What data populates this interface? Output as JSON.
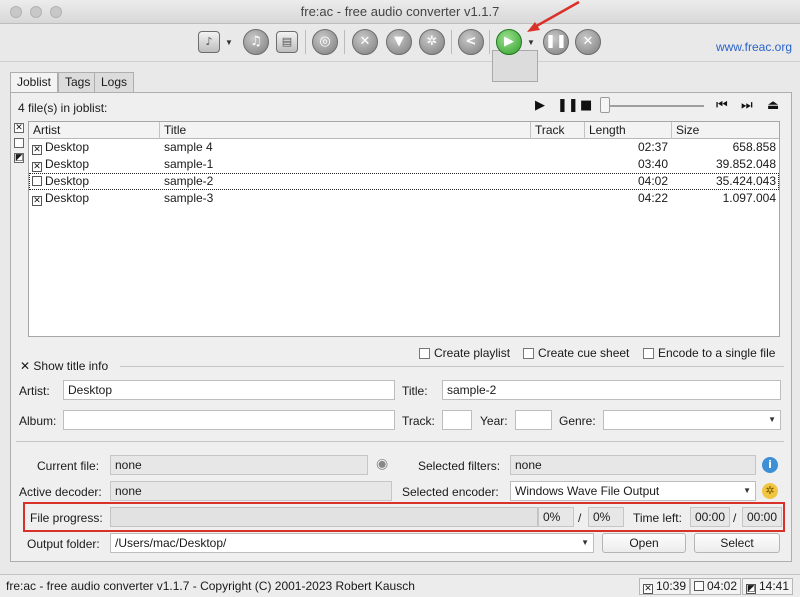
{
  "window": {
    "title": "fre:ac - free audio converter v1.1.7"
  },
  "toolbar": {
    "buttons": [
      "add-files-icon",
      "add-cd-icon",
      "add-folder-icon",
      "cddb-query-icon",
      "general-settings-icon",
      "filter-settings-icon",
      "component-settings-icon",
      "share-icon",
      "start-encoding-icon",
      "pause-encoding-icon",
      "stop-encoding-icon"
    ],
    "website": "www.freac.org"
  },
  "tabs": [
    {
      "label": "Joblist",
      "active": true
    },
    {
      "label": "Tags",
      "active": false
    },
    {
      "label": "Logs",
      "active": false
    }
  ],
  "joblist": {
    "count_text": "4 file(s) in joblist:",
    "columns": [
      "Artist",
      "Title",
      "Track",
      "Length",
      "Size"
    ],
    "rows": [
      {
        "checked": true,
        "artist": "Desktop",
        "title": "sample 4",
        "track": "",
        "length": "02:37",
        "size": "658.858"
      },
      {
        "checked": true,
        "artist": "Desktop",
        "title": "sample-1",
        "track": "",
        "length": "03:40",
        "size": "39.852.048"
      },
      {
        "checked": false,
        "artist": "Desktop",
        "title": "sample-2",
        "track": "",
        "length": "04:02",
        "size": "35.424.043"
      },
      {
        "checked": true,
        "artist": "Desktop",
        "title": "sample-3",
        "track": "",
        "length": "04:22",
        "size": "1.097.004"
      }
    ]
  },
  "options": {
    "create_playlist": "Create playlist",
    "create_cue_sheet": "Create cue sheet",
    "encode_single": "Encode to a single file"
  },
  "title_info": {
    "toggle_label": "Show title info",
    "artist_label": "Artist:",
    "artist_value": "Desktop",
    "title_label": "Title:",
    "title_value": "sample-2",
    "album_label": "Album:",
    "album_value": "",
    "track_label": "Track:",
    "track_value": "",
    "year_label": "Year:",
    "year_value": "",
    "genre_label": "Genre:",
    "genre_value": ""
  },
  "status": {
    "current_file_label": "Current file:",
    "current_file_value": "none",
    "selected_filters_label": "Selected filters:",
    "selected_filters_value": "none",
    "active_decoder_label": "Active decoder:",
    "active_decoder_value": "none",
    "selected_encoder_label": "Selected encoder:",
    "selected_encoder_value": "Windows Wave File Output",
    "file_progress_label": "File progress:",
    "file_progress_percent": "0%",
    "total_progress_percent": "0%",
    "separator": "/",
    "time_left_label": "Time left:",
    "time_left_file": "00:00",
    "time_left_total": "00:00",
    "output_folder_label": "Output folder:",
    "output_folder_value": "/Users/mac/Desktop/",
    "open_button": "Open",
    "select_button": "Select"
  },
  "statusbar": {
    "text": "fre:ac - free audio converter v1.1.7 - Copyright (C) 2001-2023 Robert Kausch",
    "time_selected": "10:39",
    "time_unselected": "04:02",
    "time_total": "14:41"
  },
  "colors": {
    "accent_link": "#2a63c9",
    "annotation_red": "#d9312a",
    "play_green": "#2e9f2a"
  }
}
